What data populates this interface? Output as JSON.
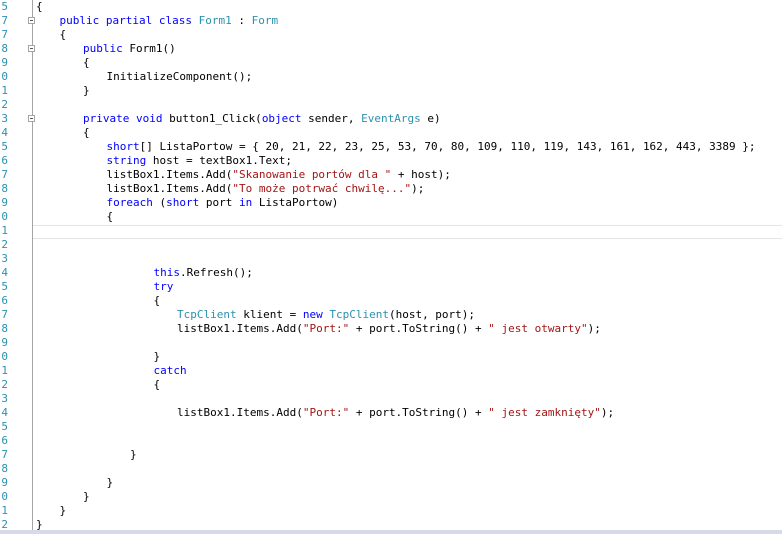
{
  "editor": {
    "lines": [
      {
        "ln": "5",
        "indent": 0,
        "tokens": [
          {
            "t": "{"
          }
        ]
      },
      {
        "ln": "7",
        "indent": 2,
        "fold": true,
        "tokens": [
          {
            "t": "public partial class ",
            "c": "kw"
          },
          {
            "t": "Form1",
            "c": "ty"
          },
          {
            "t": " : "
          },
          {
            "t": "Form",
            "c": "ty"
          }
        ]
      },
      {
        "ln": "7",
        "indent": 2,
        "tokens": [
          {
            "t": "{"
          }
        ]
      },
      {
        "ln": "8",
        "indent": 4,
        "fold": true,
        "tokens": [
          {
            "t": "public ",
            "c": "kw"
          },
          {
            "t": "Form1()"
          }
        ]
      },
      {
        "ln": "9",
        "indent": 4,
        "tokens": [
          {
            "t": "{"
          }
        ]
      },
      {
        "ln": "0",
        "indent": 6,
        "tokens": [
          {
            "t": "InitializeComponent();"
          }
        ]
      },
      {
        "ln": "1",
        "indent": 4,
        "tokens": [
          {
            "t": "}"
          }
        ]
      },
      {
        "ln": "2",
        "indent": 0,
        "tokens": []
      },
      {
        "ln": "3",
        "indent": 4,
        "fold": true,
        "tokens": [
          {
            "t": "private void ",
            "c": "kw"
          },
          {
            "t": "button1_Click("
          },
          {
            "t": "object",
            "c": "kw"
          },
          {
            "t": " sender, "
          },
          {
            "t": "EventArgs",
            "c": "ty"
          },
          {
            "t": " e)"
          }
        ]
      },
      {
        "ln": "4",
        "indent": 4,
        "tokens": [
          {
            "t": "{"
          }
        ]
      },
      {
        "ln": "5",
        "indent": 6,
        "tokens": [
          {
            "t": "short",
            "c": "kw"
          },
          {
            "t": "[] ListaPortow = { 20, 21, 22, 23, 25, 53, 70, 80, 109, 110, 119, 143, 161, 162, 443, 3389 };"
          }
        ]
      },
      {
        "ln": "6",
        "indent": 6,
        "tokens": [
          {
            "t": "string",
            "c": "kw"
          },
          {
            "t": " host = textBox1.Text;"
          }
        ]
      },
      {
        "ln": "7",
        "indent": 6,
        "tokens": [
          {
            "t": "listBox1.Items.Add("
          },
          {
            "t": "\"Skanowanie portów dla \"",
            "c": "str"
          },
          {
            "t": " + host);"
          }
        ]
      },
      {
        "ln": "8",
        "indent": 6,
        "tokens": [
          {
            "t": "listBox1.Items.Add("
          },
          {
            "t": "\"To może potrwać chwilę...\"",
            "c": "str"
          },
          {
            "t": ");"
          }
        ]
      },
      {
        "ln": "9",
        "indent": 6,
        "tokens": [
          {
            "t": "foreach",
            "c": "kw"
          },
          {
            "t": " ("
          },
          {
            "t": "short",
            "c": "kw"
          },
          {
            "t": " port "
          },
          {
            "t": "in",
            "c": "kw"
          },
          {
            "t": " ListaPortow)"
          }
        ]
      },
      {
        "ln": "0",
        "indent": 6,
        "tokens": [
          {
            "t": "{"
          }
        ]
      },
      {
        "ln": "1",
        "indent": 0,
        "tokens": []
      },
      {
        "ln": "2",
        "indent": 0,
        "tokens": []
      },
      {
        "ln": "3",
        "indent": 0,
        "tokens": []
      },
      {
        "ln": "4",
        "indent": 10,
        "tokens": [
          {
            "t": "this",
            "c": "kw"
          },
          {
            "t": ".Refresh();"
          }
        ]
      },
      {
        "ln": "5",
        "indent": 10,
        "tokens": [
          {
            "t": "try",
            "c": "kw"
          }
        ]
      },
      {
        "ln": "6",
        "indent": 10,
        "tokens": [
          {
            "t": "{"
          }
        ]
      },
      {
        "ln": "7",
        "indent": 12,
        "tokens": [
          {
            "t": "TcpClient",
            "c": "ty"
          },
          {
            "t": " klient = "
          },
          {
            "t": "new ",
            "c": "kw"
          },
          {
            "t": "TcpClient",
            "c": "ty"
          },
          {
            "t": "(host, port);"
          }
        ]
      },
      {
        "ln": "8",
        "indent": 12,
        "tokens": [
          {
            "t": "listBox1.Items.Add("
          },
          {
            "t": "\"Port:\"",
            "c": "str"
          },
          {
            "t": " + port.ToString() + "
          },
          {
            "t": "\" jest otwarty\"",
            "c": "str"
          },
          {
            "t": ");"
          }
        ]
      },
      {
        "ln": "9",
        "indent": 0,
        "tokens": []
      },
      {
        "ln": "0",
        "indent": 10,
        "tokens": [
          {
            "t": "}"
          }
        ]
      },
      {
        "ln": "1",
        "indent": 10,
        "tokens": [
          {
            "t": "catch",
            "c": "kw"
          }
        ]
      },
      {
        "ln": "2",
        "indent": 10,
        "tokens": [
          {
            "t": "{"
          }
        ]
      },
      {
        "ln": "3",
        "indent": 0,
        "tokens": []
      },
      {
        "ln": "4",
        "indent": 12,
        "tokens": [
          {
            "t": "listBox1.Items.Add("
          },
          {
            "t": "\"Port:\"",
            "c": "str"
          },
          {
            "t": " + port.ToString() + "
          },
          {
            "t": "\" jest zamknięty\"",
            "c": "str"
          },
          {
            "t": ");"
          }
        ]
      },
      {
        "ln": "5",
        "indent": 0,
        "tokens": []
      },
      {
        "ln": "6",
        "indent": 0,
        "tokens": []
      },
      {
        "ln": "7",
        "indent": 8,
        "tokens": [
          {
            "t": "}"
          }
        ]
      },
      {
        "ln": "8",
        "indent": 0,
        "tokens": []
      },
      {
        "ln": "9",
        "indent": 6,
        "tokens": [
          {
            "t": "}"
          }
        ]
      },
      {
        "ln": "0",
        "indent": 4,
        "tokens": [
          {
            "t": "}"
          }
        ]
      },
      {
        "ln": "1",
        "indent": 2,
        "tokens": [
          {
            "t": "}"
          }
        ]
      },
      {
        "ln": "2",
        "indent": 0,
        "tokens": [
          {
            "t": "}"
          }
        ]
      }
    ]
  }
}
